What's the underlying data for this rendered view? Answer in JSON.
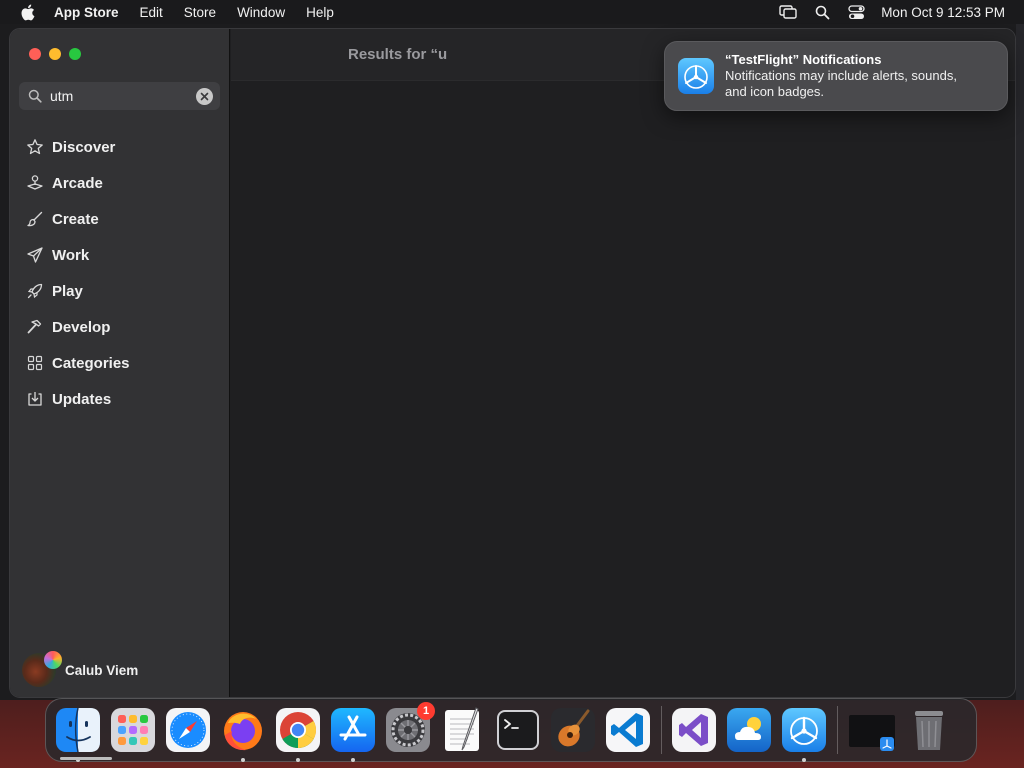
{
  "menubar": {
    "app_name": "App Store",
    "menus": [
      "Edit",
      "Store",
      "Window",
      "Help"
    ],
    "status_icons": [
      "screen-mirroring-icon",
      "spotlight-search-icon",
      "control-center-icon"
    ],
    "clock": "Mon Oct 9  12:53 PM"
  },
  "window": {
    "search": {
      "value": "utm",
      "placeholder": ""
    },
    "nav": [
      {
        "label": "Discover",
        "icon": "star-icon"
      },
      {
        "label": "Arcade",
        "icon": "joystick-icon"
      },
      {
        "label": "Create",
        "icon": "paintbrush-icon"
      },
      {
        "label": "Work",
        "icon": "paperplane-icon"
      },
      {
        "label": "Play",
        "icon": "rocket-icon"
      },
      {
        "label": "Develop",
        "icon": "hammer-icon"
      },
      {
        "label": "Categories",
        "icon": "grid-icon"
      },
      {
        "label": "Updates",
        "icon": "download-icon"
      }
    ],
    "account_name": "Calub Viem",
    "results_title": "Results for “u"
  },
  "notification": {
    "title": "“TestFlight” Notifications",
    "body_line1": "Notifications may include alerts, sounds,",
    "body_line2": "and icon badges."
  },
  "dock": {
    "items": [
      "Finder",
      "Launchpad",
      "Safari",
      "Firefox",
      "Google Chrome",
      "App Store",
      "System Settings",
      "TextEdit",
      "Terminal",
      "GarageBand",
      "Visual Studio Code",
      "Visual Studio",
      "Weather",
      "TestFlight"
    ],
    "system_settings_badge": "1",
    "colors": {
      "accent_blue": "#1a8cff",
      "badge_red": "#ff3b30"
    }
  }
}
